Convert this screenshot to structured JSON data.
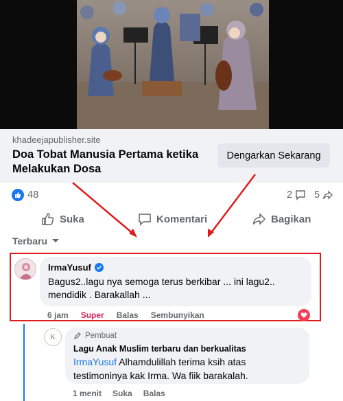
{
  "media": {
    "alt": "animated illustration of hijab girls orchestra"
  },
  "link": {
    "domain": "khadeejapublisher.site",
    "title": "Doa Tobat Manusia Pertama ketika Melakukan Dosa",
    "cta_label": "Dengarkan Sekarang"
  },
  "stats": {
    "likes": "48",
    "comments": "2",
    "shares": "5"
  },
  "actions": {
    "like": "Suka",
    "comment": "Komentari",
    "share": "Bagikan"
  },
  "sort": {
    "label": "Terbaru"
  },
  "comment1": {
    "author": "IrmaYusuf",
    "text": "Bagus2..lagu nya semoga terus berkibar ... ini lagu2.. mendidik . Barakallah ...",
    "time": "6 jam",
    "reaction": "Super",
    "reply": "Balas",
    "hide": "Sembunyikan"
  },
  "comment2": {
    "badge": "Pembuat",
    "author": "Lagu Anak Muslim terbaru dan berkualitas",
    "mention": "IrmaYusuf",
    "text": " Alhamdulillah terima ksih atas testimoninya kak Irma. Wa fiik barakalah.",
    "time": "1 menit",
    "like": "Suka",
    "reply": "Balas"
  },
  "colors": {
    "accent": "#1877f2",
    "highlight": "#e01b1b",
    "love": "#f33e58"
  }
}
